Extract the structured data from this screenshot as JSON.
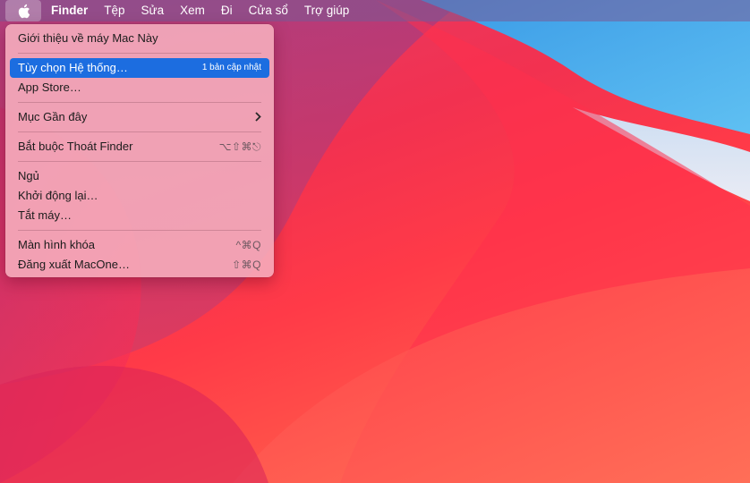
{
  "menubar": {
    "apple_icon": "apple-logo-icon",
    "items": [
      {
        "label": "Finder"
      },
      {
        "label": "Tệp"
      },
      {
        "label": "Sửa"
      },
      {
        "label": "Xem"
      },
      {
        "label": "Đi"
      },
      {
        "label": "Cửa sổ"
      },
      {
        "label": "Trợ giúp"
      }
    ]
  },
  "apple_menu": {
    "about": "Giới thiệu về máy Mac Này",
    "system_prefs": "Tùy chọn Hệ thống…",
    "system_prefs_badge": "1 bản cập nhật",
    "app_store": "App Store…",
    "recent_items": "Mục Gần đây",
    "force_quit": "Bắt buộc Thoát Finder",
    "force_quit_shortcut": "⌥⇧⌘⎋",
    "sleep": "Ngủ",
    "restart": "Khởi động lại…",
    "shutdown": "Tắt máy…",
    "lock_screen": "Màn hình khóa",
    "lock_screen_shortcut": "^⌘Q",
    "logout": "Đăng xuất MacOne…",
    "logout_shortcut": "⇧⌘Q"
  },
  "colors": {
    "selection": "#1c6de0",
    "wallpaper_red": "#f23150",
    "wallpaper_blue": "#4aa8e8"
  }
}
